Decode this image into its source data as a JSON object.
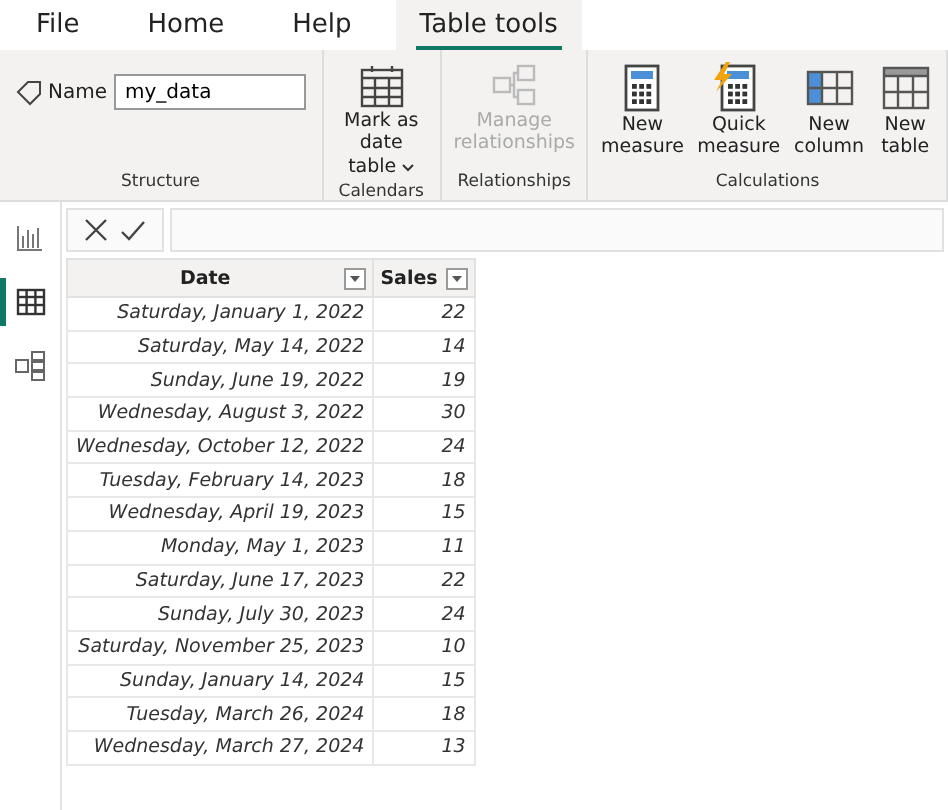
{
  "tabs": [
    {
      "label": "File",
      "selected": false
    },
    {
      "label": "Home",
      "selected": false
    },
    {
      "label": "Help",
      "selected": false
    },
    {
      "label": "Table tools",
      "selected": true
    }
  ],
  "ribbon": {
    "groups": [
      {
        "label": "Structure",
        "name_field": {
          "label": "Name",
          "value": "my_data"
        }
      },
      {
        "label": "Calendars",
        "buttons": [
          {
            "kind": "calendar",
            "label": "Mark as date table",
            "dropdown": true,
            "disabled": false
          }
        ]
      },
      {
        "label": "Relationships",
        "buttons": [
          {
            "kind": "relationships",
            "label": "Manage relationships",
            "dropdown": false,
            "disabled": true
          }
        ]
      },
      {
        "label": "Calculations",
        "buttons": [
          {
            "kind": "calculator",
            "label": "New measure",
            "dropdown": false,
            "disabled": false
          },
          {
            "kind": "quick-calculator",
            "label": "Quick measure",
            "dropdown": false,
            "disabled": false
          },
          {
            "kind": "column",
            "label": "New column",
            "dropdown": false,
            "disabled": false
          },
          {
            "kind": "table",
            "label": "New table",
            "dropdown": false,
            "disabled": false
          }
        ]
      }
    ]
  },
  "sidebar": {
    "items": [
      {
        "selected": false
      },
      {
        "selected": true
      },
      {
        "selected": false
      }
    ]
  },
  "table": {
    "columns": [
      "Date",
      "Sales"
    ],
    "rows": [
      [
        "Saturday, January 1, 2022",
        "22"
      ],
      [
        "Saturday, May 14, 2022",
        "14"
      ],
      [
        "Sunday, June 19, 2022",
        "19"
      ],
      [
        "Wednesday, August 3, 2022",
        "30"
      ],
      [
        "Wednesday, October 12, 2022",
        "24"
      ],
      [
        "Tuesday, February 14, 2023",
        "18"
      ],
      [
        "Wednesday, April 19, 2023",
        "15"
      ],
      [
        "Monday, May 1, 2023",
        "11"
      ],
      [
        "Saturday, June 17, 2023",
        "22"
      ],
      [
        "Sunday, July 30, 2023",
        "24"
      ],
      [
        "Saturday, November 25, 2023",
        "10"
      ],
      [
        "Sunday, January 14, 2024",
        "15"
      ],
      [
        "Tuesday, March 26, 2024",
        "18"
      ],
      [
        "Wednesday, March 27, 2024",
        "13"
      ]
    ]
  }
}
